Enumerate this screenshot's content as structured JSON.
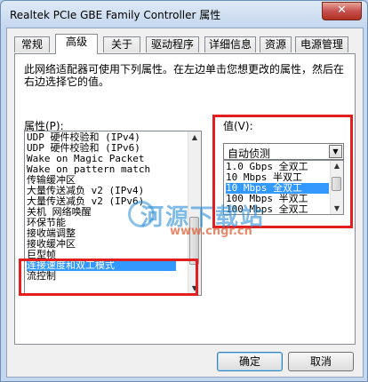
{
  "window": {
    "title": "Realtek PCIe GBE Family Controller 属性",
    "close_glyph": "✕"
  },
  "tabs": [
    {
      "label": "常规"
    },
    {
      "label": "高级"
    },
    {
      "label": "关于"
    },
    {
      "label": "驱动程序"
    },
    {
      "label": "详细信息"
    },
    {
      "label": "资源"
    },
    {
      "label": "电源管理"
    }
  ],
  "advanced": {
    "description": "此网络适配器可使用下列属性。在左边单击您想更改的属性，然后在右边选择它的值。",
    "property_label": "属性(P):",
    "value_label": "值(V):",
    "properties": [
      {
        "label": "UDP 硬件校验和 (IPv4)"
      },
      {
        "label": "UDP 硬件校验和 (IPv6)"
      },
      {
        "label": "Wake on Magic Packet"
      },
      {
        "label": "Wake on pattern match"
      },
      {
        "label": "传输缓冲区"
      },
      {
        "label": "大量传送减负 v2 (IPv4)"
      },
      {
        "label": "大量传送减负 v2 (IPv6)"
      },
      {
        "label": "关机 网络唤醒"
      },
      {
        "label": "环保节能"
      },
      {
        "label": "接收端调整"
      },
      {
        "label": "接收缓冲区"
      },
      {
        "label": "巨型帧"
      },
      {
        "label": "连接速度和双工模式"
      },
      {
        "label": "流控制"
      }
    ],
    "selected_property": "连接速度和双工模式",
    "value_selected": "自动侦测",
    "value_options": [
      {
        "label": "1.0 Gbps 全双工"
      },
      {
        "label": "10 Mbps 半双工"
      },
      {
        "label": "10 Mbps 全双工"
      },
      {
        "label": "100 Mbps 半双工"
      },
      {
        "label": "100 Mbps 全双工"
      }
    ]
  },
  "watermark": {
    "text": "河源下载站",
    "url": "www.cngr.cn"
  },
  "buttons": {
    "ok": "确定",
    "cancel": "取消"
  },
  "colors": {
    "selection": "#3399ff",
    "highlight_box": "#e21e1e"
  }
}
